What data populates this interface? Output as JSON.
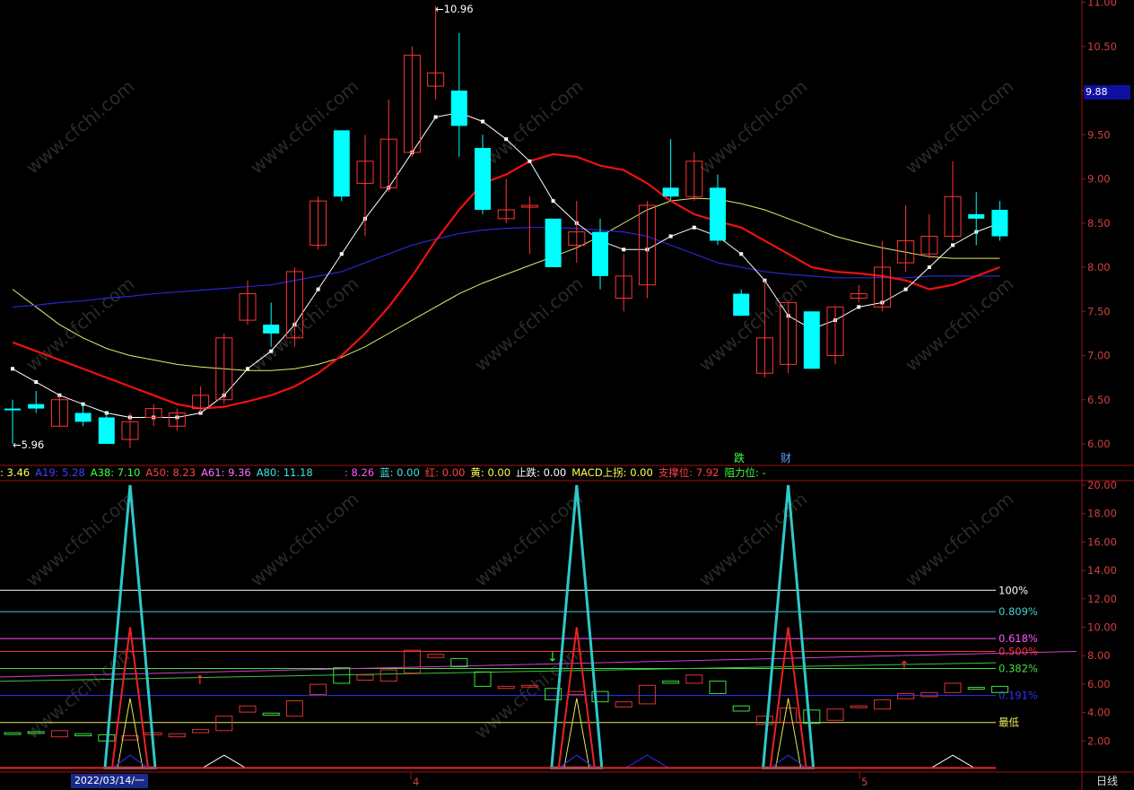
{
  "chart_data": [
    {
      "type": "candlestick",
      "title": "",
      "y_ticks": [
        "11.00",
        "10.50",
        "10.00",
        "9.50",
        "9.00",
        "8.50",
        "8.00",
        "7.50",
        "7.00",
        "6.50",
        "6.00"
      ],
      "ylim": [
        5.8,
        11.0
      ],
      "last_price": "9.88",
      "high_label": "10.96",
      "low_label": "5.96",
      "event_labels": [
        "跌",
        "财"
      ],
      "candles": [
        {
          "o": 6.4,
          "h": 6.5,
          "l": 6.0,
          "c": 6.4,
          "up": false
        },
        {
          "o": 6.45,
          "h": 6.6,
          "l": 6.35,
          "c": 6.4,
          "up": false
        },
        {
          "o": 6.2,
          "h": 6.55,
          "l": 6.2,
          "c": 6.5,
          "up": true
        },
        {
          "o": 6.35,
          "h": 6.45,
          "l": 6.2,
          "c": 6.25,
          "up": false
        },
        {
          "o": 6.3,
          "h": 6.35,
          "l": 6.0,
          "c": 6.0,
          "up": false
        },
        {
          "o": 6.05,
          "h": 6.35,
          "l": 5.95,
          "c": 6.25,
          "up": true
        },
        {
          "o": 6.3,
          "h": 6.45,
          "l": 6.2,
          "c": 6.4,
          "up": true
        },
        {
          "o": 6.2,
          "h": 6.4,
          "l": 6.15,
          "c": 6.35,
          "up": true
        },
        {
          "o": 6.4,
          "h": 6.65,
          "l": 6.35,
          "c": 6.55,
          "up": true
        },
        {
          "o": 6.5,
          "h": 7.25,
          "l": 6.45,
          "c": 7.2,
          "up": true
        },
        {
          "o": 7.4,
          "h": 7.85,
          "l": 7.35,
          "c": 7.7,
          "up": true
        },
        {
          "o": 7.35,
          "h": 7.6,
          "l": 7.1,
          "c": 7.25,
          "up": false
        },
        {
          "o": 7.2,
          "h": 8.0,
          "l": 7.1,
          "c": 7.95,
          "up": true
        },
        {
          "o": 8.25,
          "h": 8.8,
          "l": 8.2,
          "c": 8.75,
          "up": true
        },
        {
          "o": 9.55,
          "h": 9.55,
          "l": 8.75,
          "c": 8.8,
          "up": false
        },
        {
          "o": 8.95,
          "h": 9.5,
          "l": 8.35,
          "c": 9.2,
          "up": true
        },
        {
          "o": 8.9,
          "h": 9.9,
          "l": 8.85,
          "c": 9.45,
          "up": true
        },
        {
          "o": 9.3,
          "h": 10.5,
          "l": 9.25,
          "c": 10.4,
          "up": true
        },
        {
          "o": 10.05,
          "h": 10.96,
          "l": 9.9,
          "c": 10.2,
          "up": true
        },
        {
          "o": 10.0,
          "h": 10.65,
          "l": 9.25,
          "c": 9.6,
          "up": false
        },
        {
          "o": 9.35,
          "h": 9.5,
          "l": 8.6,
          "c": 8.65,
          "up": false
        },
        {
          "o": 8.55,
          "h": 9.0,
          "l": 8.5,
          "c": 8.65,
          "up": true
        },
        {
          "o": 8.7,
          "h": 8.8,
          "l": 8.15,
          "c": 8.7,
          "up": true
        },
        {
          "o": 8.55,
          "h": 8.55,
          "l": 8.0,
          "c": 8.0,
          "up": false
        },
        {
          "o": 8.25,
          "h": 8.75,
          "l": 8.05,
          "c": 8.4,
          "up": true
        },
        {
          "o": 8.4,
          "h": 8.55,
          "l": 7.75,
          "c": 7.9,
          "up": false
        },
        {
          "o": 7.65,
          "h": 8.15,
          "l": 7.5,
          "c": 7.9,
          "up": true
        },
        {
          "o": 7.8,
          "h": 8.75,
          "l": 7.65,
          "c": 8.7,
          "up": true
        },
        {
          "o": 8.8,
          "h": 9.45,
          "l": 8.75,
          "c": 8.9,
          "up": false
        },
        {
          "o": 8.8,
          "h": 9.3,
          "l": 8.75,
          "c": 9.2,
          "up": true
        },
        {
          "o": 8.9,
          "h": 9.05,
          "l": 8.25,
          "c": 8.3,
          "up": false
        },
        {
          "o": 7.7,
          "h": 7.75,
          "l": 7.45,
          "c": 7.45,
          "up": false
        },
        {
          "o": 6.8,
          "h": 7.85,
          "l": 6.75,
          "c": 7.2,
          "up": true
        },
        {
          "o": 6.9,
          "h": 7.6,
          "l": 6.8,
          "c": 7.6,
          "up": true
        },
        {
          "o": 7.5,
          "h": 7.5,
          "l": 6.85,
          "c": 6.85,
          "up": false
        },
        {
          "o": 7.0,
          "h": 7.55,
          "l": 6.9,
          "c": 7.55,
          "up": true
        },
        {
          "o": 7.65,
          "h": 7.8,
          "l": 7.6,
          "c": 7.7,
          "up": true
        },
        {
          "o": 7.55,
          "h": 8.3,
          "l": 7.5,
          "c": 8.0,
          "up": true
        },
        {
          "o": 8.05,
          "h": 8.7,
          "l": 7.95,
          "c": 8.3,
          "up": true
        },
        {
          "o": 8.15,
          "h": 8.6,
          "l": 8.1,
          "c": 8.35,
          "up": true
        },
        {
          "o": 8.35,
          "h": 9.2,
          "l": 8.3,
          "c": 8.8,
          "up": true
        },
        {
          "o": 8.6,
          "h": 8.85,
          "l": 8.25,
          "c": 8.55,
          "up": false
        },
        {
          "o": 8.65,
          "h": 8.75,
          "l": 8.3,
          "c": 8.35,
          "up": false
        }
      ],
      "ma_white": [
        6.85,
        6.7,
        6.55,
        6.45,
        6.35,
        6.3,
        6.3,
        6.3,
        6.35,
        6.55,
        6.85,
        7.05,
        7.35,
        7.75,
        8.15,
        8.55,
        8.9,
        9.3,
        9.7,
        9.75,
        9.65,
        9.45,
        9.2,
        8.75,
        8.5,
        8.3,
        8.2,
        8.2,
        8.35,
        8.45,
        8.35,
        8.15,
        7.85,
        7.45,
        7.3,
        7.4,
        7.55,
        7.6,
        7.75,
        8.0,
        8.25,
        8.4,
        8.5
      ],
      "ma_red": [
        7.15,
        7.05,
        6.95,
        6.85,
        6.75,
        6.65,
        6.55,
        6.45,
        6.4,
        6.42,
        6.48,
        6.55,
        6.65,
        6.8,
        7.0,
        7.25,
        7.55,
        7.9,
        8.3,
        8.65,
        8.95,
        9.05,
        9.2,
        9.28,
        9.25,
        9.15,
        9.1,
        8.95,
        8.75,
        8.6,
        8.52,
        8.45,
        8.3,
        8.15,
        8.0,
        7.95,
        7.93,
        7.9,
        7.85,
        7.75,
        7.8,
        7.9,
        8.0
      ],
      "ma_blue": [
        7.55,
        7.57,
        7.6,
        7.62,
        7.65,
        7.67,
        7.7,
        7.72,
        7.74,
        7.76,
        7.78,
        7.8,
        7.85,
        7.9,
        7.95,
        8.05,
        8.15,
        8.25,
        8.32,
        8.38,
        8.42,
        8.44,
        8.45,
        8.45,
        8.44,
        8.42,
        8.4,
        8.35,
        8.25,
        8.15,
        8.05,
        8.0,
        7.95,
        7.92,
        7.9,
        7.88,
        7.88,
        7.88,
        7.88,
        7.9,
        7.9,
        7.9,
        7.9
      ],
      "ma_yellow": [
        7.75,
        7.55,
        7.35,
        7.2,
        7.08,
        7.0,
        6.95,
        6.9,
        6.87,
        6.85,
        6.83,
        6.83,
        6.85,
        6.9,
        6.98,
        7.1,
        7.25,
        7.4,
        7.55,
        7.7,
        7.82,
        7.92,
        8.02,
        8.12,
        8.22,
        8.35,
        8.5,
        8.65,
        8.75,
        8.78,
        8.77,
        8.72,
        8.65,
        8.55,
        8.45,
        8.35,
        8.28,
        8.22,
        8.17,
        8.12,
        8.1,
        8.1,
        8.1
      ]
    },
    {
      "type": "line",
      "title": "",
      "y_ticks": [
        "20.00",
        "18.00",
        "16.00",
        "14.00",
        "12.00",
        "10.00",
        "8.00",
        "6.00",
        "4.00",
        "2.00"
      ],
      "ylim": [
        0,
        20.5
      ],
      "levels": [
        {
          "label": "100%",
          "value": 12.6,
          "color": "#ffffff"
        },
        {
          "label": "0.809%",
          "value": 11.1,
          "color": "#3fd0d0"
        },
        {
          "label": "0.618%",
          "value": 9.2,
          "color": "#ff55ff"
        },
        {
          "label": "0.500%",
          "value": 8.3,
          "color": "#ff3030"
        },
        {
          "label": "0.382%",
          "value": 7.1,
          "color": "#40e040"
        },
        {
          "label": "0.191%",
          "value": 5.2,
          "color": "#3030ff"
        },
        {
          "label": "最低",
          "value": 3.3,
          "color": "#e8e860"
        }
      ],
      "spike_x": [
        5,
        24,
        33
      ],
      "indicator_labels": [
        {
          "label": ": 3.46",
          "color": "#ffff55"
        },
        {
          "label": "A19: 5.28",
          "color": "#4040ff"
        },
        {
          "label": "A38: 7.10",
          "color": "#40ff40"
        },
        {
          "label": "A50: 8.23",
          "color": "#ff4040"
        },
        {
          "label": "A61: 9.36",
          "color": "#ff70ff"
        },
        {
          "label": "A80: 11.18",
          "color": "#40e0e0"
        }
      ],
      "indicator_labels_2": [
        {
          "label": ": 8.26",
          "color": "#ff55ff"
        },
        {
          "label": "蓝: 0.00",
          "color": "#40e0e0"
        },
        {
          "label": "红: 0.00",
          "color": "#ff4040"
        },
        {
          "label": "黄: 0.00",
          "color": "#ffff55"
        },
        {
          "label": "止跌: 0.00",
          "color": "#ffffff"
        },
        {
          "label": "MACD上拐: 0.00",
          "color": "#ffff55"
        },
        {
          "label": "支撑位: 7.92",
          "color": "#ff4040"
        },
        {
          "label": "阻力位: -",
          "color": "#40ff40"
        }
      ]
    }
  ],
  "x_axis": {
    "date_label": "2022/03/14/一",
    "month_ticks": [
      "4",
      "5"
    ]
  },
  "period_label": "日线",
  "watermark": "www.cfchi.com",
  "colors": {
    "up": "#ff3333",
    "down": "#00ffff",
    "background": "#000000",
    "frame": "#a01010"
  }
}
